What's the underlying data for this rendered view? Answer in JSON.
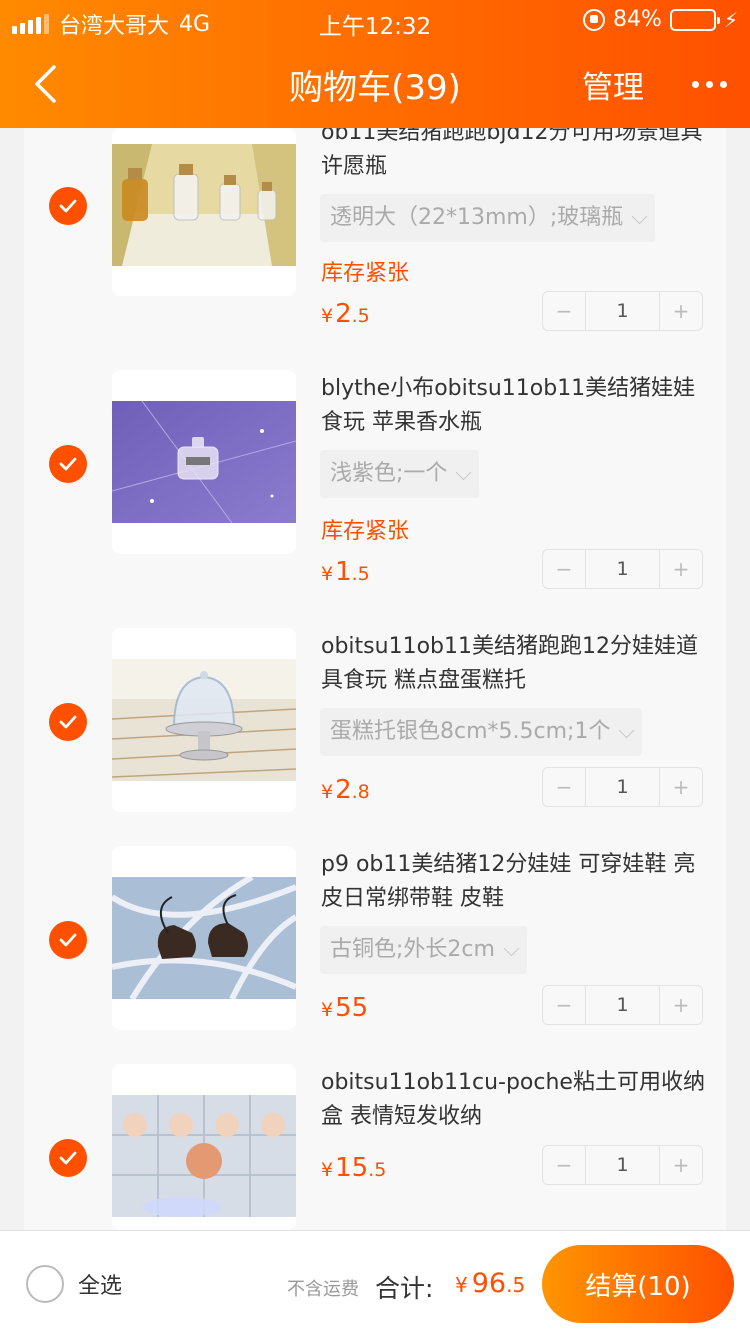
{
  "status_bar": {
    "carrier": "台湾大哥大",
    "network": "4G",
    "time": "上午12:32",
    "battery_percent": "84%",
    "battery_level": 0.84
  },
  "nav": {
    "title": "购物车(39)",
    "manage": "管理",
    "back_icon": "chevron-left-icon",
    "more_icon": "more-dots-icon"
  },
  "items": [
    {
      "title": "ob11美结猪跑跑bjd12分可用场景道具 许愿瓶",
      "sku": "透明大（22*13mm）;玻璃瓶",
      "stock": "库存紧张",
      "price_symbol": "¥",
      "price_int": "2",
      "price_dec": ".5",
      "quantity": "1",
      "checked": true
    },
    {
      "title": "blythe小布obitsu11ob11美结猪娃娃食玩 苹果香水瓶",
      "sku": "浅紫色;一个",
      "stock": "库存紧张",
      "price_symbol": "¥",
      "price_int": "1",
      "price_dec": ".5",
      "quantity": "1",
      "checked": true
    },
    {
      "title": "obitsu11ob11美结猪跑跑12分娃娃道具食玩 糕点盘蛋糕托",
      "sku": "蛋糕托银色8cm*5.5cm;1个",
      "stock": "",
      "price_symbol": "¥",
      "price_int": "2",
      "price_dec": ".8",
      "quantity": "1",
      "checked": true
    },
    {
      "title": "p9 ob11美结猪12分娃娃 可穿娃鞋 亮皮日常绑带鞋 皮鞋",
      "sku": "古铜色;外长2cm",
      "stock": "",
      "price_symbol": "¥",
      "price_int": "55",
      "price_dec": "",
      "quantity": "1",
      "checked": true
    },
    {
      "title": "obitsu11ob11cu-poche粘土可用收纳盒 表情短发收纳",
      "sku": "",
      "stock": "",
      "price_symbol": "¥",
      "price_int": "15",
      "price_dec": ".5",
      "quantity": "1",
      "checked": true
    }
  ],
  "stepper": {
    "minus": "−",
    "plus": "+"
  },
  "footer": {
    "select_all": "全选",
    "shipping_note": "不含运费",
    "total_label": "合计:",
    "total_symbol": "¥",
    "total_int": "96",
    "total_dec": ".5",
    "checkout": "结算(10)"
  },
  "colors": {
    "accent": "#ff5000",
    "header_start": "#ff8a00",
    "header_end": "#ff5000",
    "battery": "#4cd964"
  }
}
